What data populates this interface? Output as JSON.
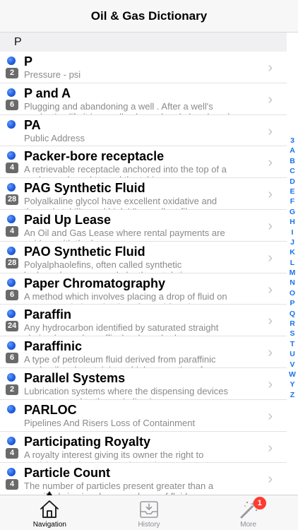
{
  "navbar": {
    "title": "Oil & Gas Dictionary"
  },
  "section": {
    "header": "P"
  },
  "entries": [
    {
      "term": "P",
      "count": "2",
      "definition": "Pressure - psi"
    },
    {
      "term": "P and A",
      "count": "6",
      "definition": "Plugging and abandoning a well . After a well's productive life it is usually plugged and abandoned"
    },
    {
      "term": "PA",
      "count": "",
      "definition": "Public Address"
    },
    {
      "term": "Packer-bore receptacle",
      "count": "4",
      "definition": "A retrievable receptacle anchored into the top of a packer and used to seal the tubing"
    },
    {
      "term": "PAG Synthetic Fluid",
      "count": "28",
      "definition": "Polyalkaline glycol have excellent oxidative and thermal stability and high VI, excellent film"
    },
    {
      "term": "Paid Up Lease",
      "count": "4",
      "definition": "An Oil and Gas Lease where rental payments are paid up with the lease"
    },
    {
      "term": "PAO Synthetic Fluid",
      "count": "28",
      "definition": "Polyalphaolefins, often called synthetic hydrocarbons, are made by the catalytic"
    },
    {
      "term": "Paper Chromatography",
      "count": "6",
      "definition": "A method which involves placing a drop of fluid on a paper and observing how far and fast the"
    },
    {
      "term": "Paraffin",
      "count": "24",
      "definition": "Any hydrocarbon identified by saturated straight chains (normal paraffins) or branched"
    },
    {
      "term": "Paraffinic",
      "count": "6",
      "definition": "A type of petroleum fluid derived from paraffinic crude oil and containing a high proportion of"
    },
    {
      "term": "Parallel Systems",
      "count": "2",
      "definition": " Lubrication systems where the dispensing devices are connected to the main line in"
    },
    {
      "term": "PARLOC",
      "count": "",
      "definition": "Pipelines And Risers Loss of Containment"
    },
    {
      "term": "Participating Royalty",
      "count": "4",
      "definition": "A royalty interest giving its owner the right to participate in bonuses and rentals"
    },
    {
      "term": "Particle Count",
      "count": "4",
      "definition": "The number of particles present greater than a specified size in a known volume of fluid"
    }
  ],
  "index_letters": [
    "3",
    "A",
    "B",
    "C",
    "D",
    "E",
    "F",
    "G",
    "H",
    "I",
    "J",
    "K",
    "L",
    "M",
    "N",
    "O",
    "P",
    "Q",
    "R",
    "S",
    "T",
    "U",
    "V",
    "W",
    "Y",
    "Z"
  ],
  "tabs": [
    {
      "label": "Navigation",
      "icon": "home-icon",
      "active": true
    },
    {
      "label": "History",
      "icon": "inbox-tray-icon",
      "active": false
    },
    {
      "label": "More",
      "icon": "magic-wand-icon",
      "active": false,
      "badge": "1"
    }
  ],
  "colors": {
    "accent": "#1a73e8",
    "dot": "#1f5ee0",
    "badge_bg": "#6a6a6a",
    "tab_badge": "#ff3b30"
  }
}
